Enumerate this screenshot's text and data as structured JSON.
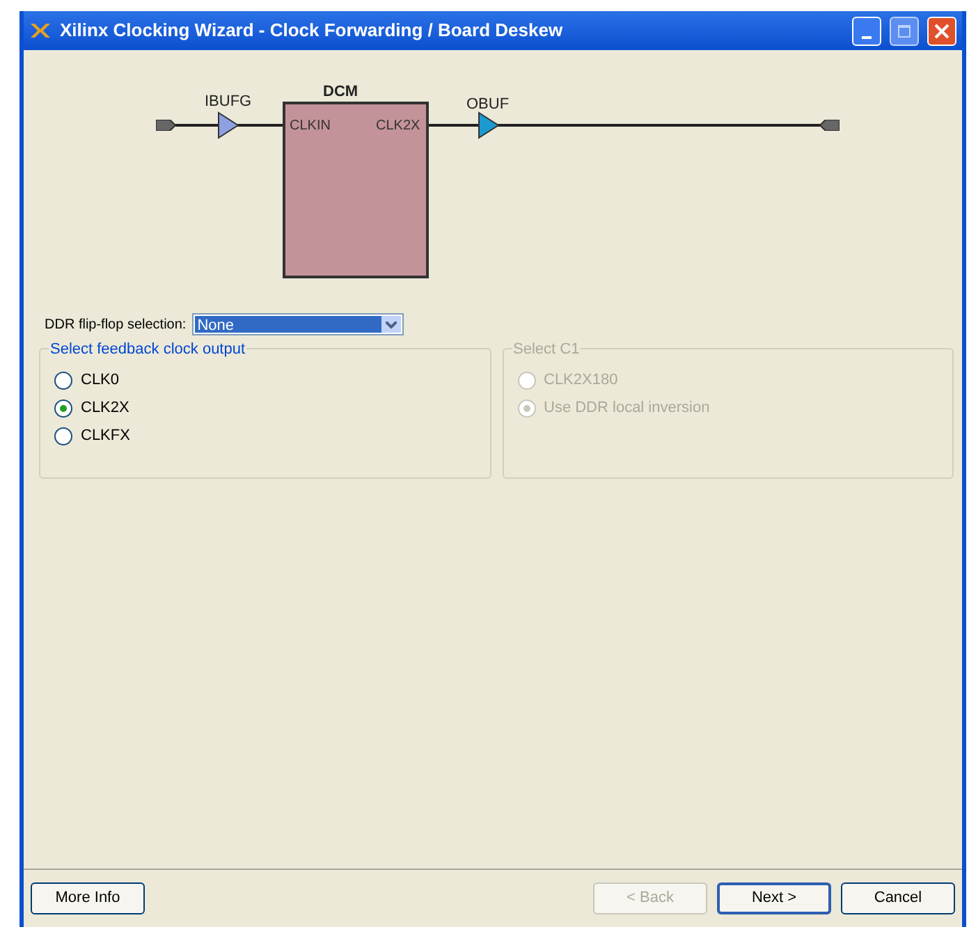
{
  "window": {
    "title": "Xilinx Clocking Wizard - Clock Forwarding / Board Deskew"
  },
  "diagram": {
    "input_buffer": "IBUFG",
    "block": "DCM",
    "block_input": "CLKIN",
    "block_output": "CLK2X",
    "output_buffer": "OBUF"
  },
  "ddr_selection": {
    "label": "DDR flip-flop selection:",
    "value": "None"
  },
  "groups": [
    {
      "title": "Select feedback clock output",
      "disabled": false,
      "options": [
        {
          "label": "CLK0",
          "selected": false
        },
        {
          "label": "CLK2X",
          "selected": true
        },
        {
          "label": "CLKFX",
          "selected": false
        }
      ]
    },
    {
      "title": "Select C1",
      "disabled": true,
      "options": [
        {
          "label": "CLK2X180",
          "selected": false
        },
        {
          "label": "Use DDR local inversion",
          "selected": true
        }
      ]
    }
  ],
  "buttons": [
    {
      "label": "More Info",
      "disabled": false,
      "default": false
    },
    {
      "label": "< Back",
      "disabled": true,
      "default": false
    },
    {
      "label": "Next >",
      "disabled": false,
      "default": true
    },
    {
      "label": "Cancel",
      "disabled": false,
      "default": false
    }
  ]
}
